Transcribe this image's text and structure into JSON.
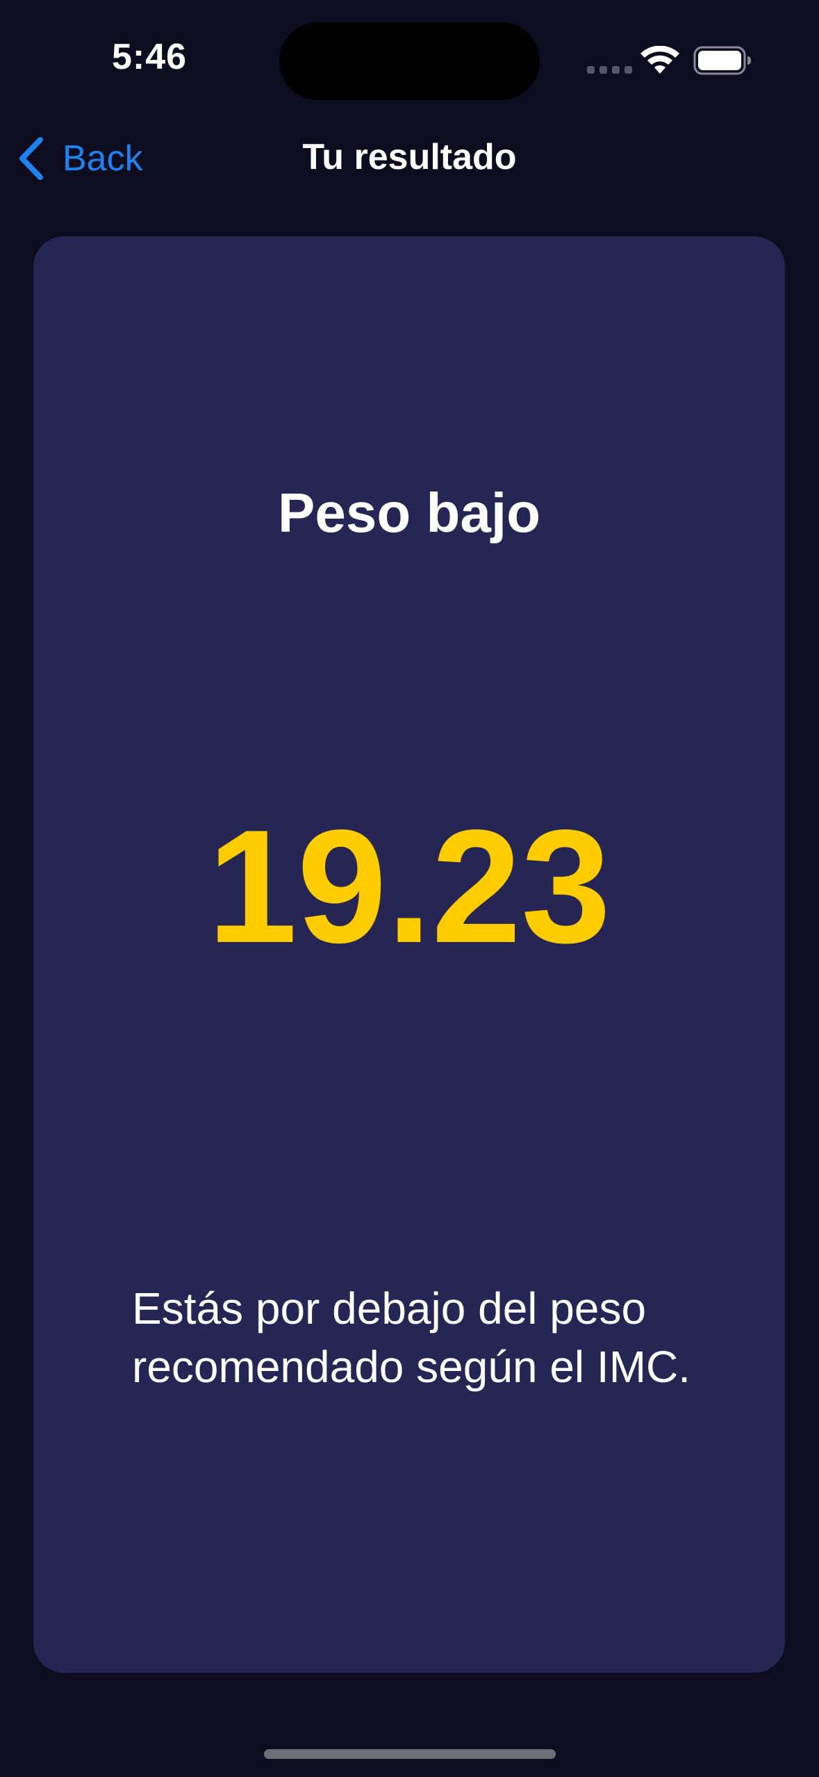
{
  "status_bar": {
    "time": "5:46"
  },
  "nav": {
    "back_label": "Back",
    "title": "Tu resultado"
  },
  "result": {
    "category": "Peso bajo",
    "bmi_value": "19.23",
    "message": "Estás por debajo del peso recomendado según el IMC."
  },
  "colors": {
    "background": "#0e0d20",
    "card": "#252653",
    "accent_value": "#ffcc00",
    "link": "#1e82f0"
  },
  "icons": {
    "back": "chevron-left-icon",
    "wifi": "wifi-icon",
    "battery": "battery-icon",
    "signal": "cellular-signal-icon"
  }
}
